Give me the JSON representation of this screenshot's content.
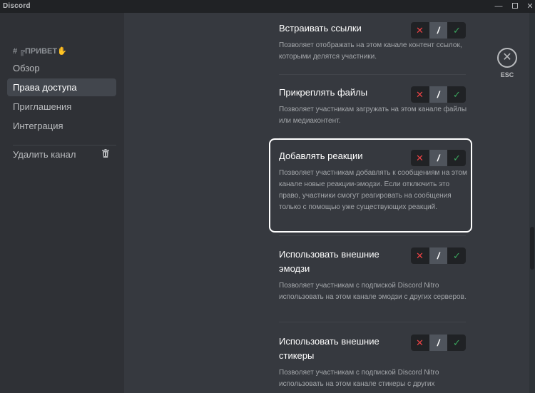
{
  "window": {
    "app_name": "Discord",
    "minimize": "—",
    "close": "✕"
  },
  "sidebar": {
    "channel_name": "# ╔ПРИВЕТ",
    "channel_emoji": "✋",
    "items": [
      {
        "label": "Обзор",
        "active": false
      },
      {
        "label": "Права доступа",
        "active": true
      },
      {
        "label": "Приглашения",
        "active": false
      },
      {
        "label": "Интеграция",
        "active": false
      }
    ],
    "delete_label": "Удалить канал",
    "delete_icon": "trash-icon"
  },
  "close_button": {
    "icon": "✕",
    "label": "ESC"
  },
  "toggle_symbols": {
    "deny": "✕",
    "neutral": "/",
    "allow": "✓"
  },
  "colors": {
    "deny": "#ed4245",
    "allow": "#3ba55d",
    "background": "#36393f",
    "sidebar": "#2f3136"
  },
  "permissions": [
    {
      "title": "Встраивать ссылки",
      "description": "Позволяет отображать на этом канале контент ссылок, которыми делятся участники.",
      "state": "neutral"
    },
    {
      "title": "Прикреплять файлы",
      "description": "Позволяет участникам загружать на этом канале файлы или медиаконтент.",
      "state": "neutral"
    },
    {
      "title": "Добавлять реакции",
      "description": "Позволяет участникам добавлять к сообщениям на этом канале новые реакции-эмодзи. Если отключить это право, участники смогут реагировать на сообщения только с помощью уже существующих реакций.",
      "state": "neutral",
      "highlighted": true
    },
    {
      "title": "Использовать внешние эмодзи",
      "description": "Позволяет участникам с подпиской Discord Nitro использовать на этом канале эмодзи с других серверов.",
      "state": "neutral"
    },
    {
      "title": "Использовать внешние стикеры",
      "description": "Позволяет участникам с подпиской Discord Nitro использовать на этом канале стикеры с других серверов.",
      "state": "neutral"
    }
  ]
}
